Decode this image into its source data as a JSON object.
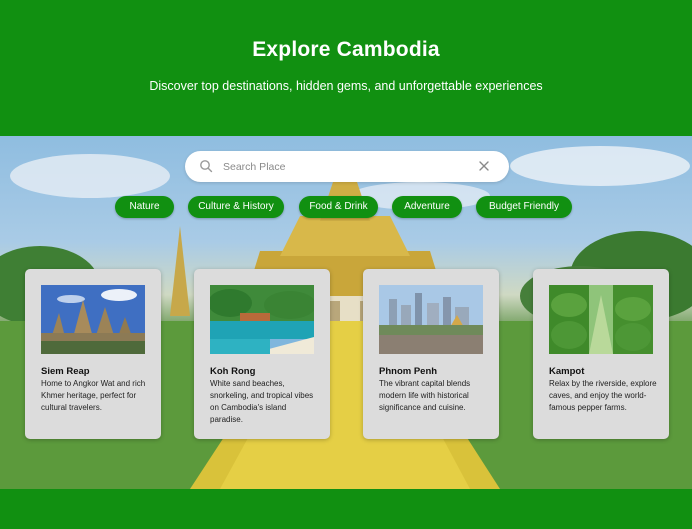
{
  "header": {
    "title": "Explore Cambodia",
    "subtitle": "Discover top destinations, hidden gems, and unforgettable experiences"
  },
  "search": {
    "placeholder": "Search Place",
    "value": "",
    "search_icon": "search-icon",
    "clear_icon": "close-icon"
  },
  "filters": [
    "Nature",
    "Culture & History",
    "Food & Drink",
    "Adventure",
    "Budget Friendly"
  ],
  "destinations": [
    {
      "name": "Siem Reap",
      "description": "Home to Angkor Wat and rich Khmer heritage, perfect for cultural travelers."
    },
    {
      "name": "Koh Rong",
      "description": "White sand beaches, snorkeling, and tropical vibes on Cambodia's island paradise."
    },
    {
      "name": "Phnom Penh",
      "description": "The vibrant capital blends modern life with historical significance and cuisine."
    },
    {
      "name": "Kampot",
      "description": "Relax by the riverside, explore caves, and enjoy the world-famous pepper farms."
    }
  ],
  "colors": {
    "brand_green": "#119011",
    "card_bg": "#dcdcdc",
    "search_bg": "#ffffff"
  }
}
